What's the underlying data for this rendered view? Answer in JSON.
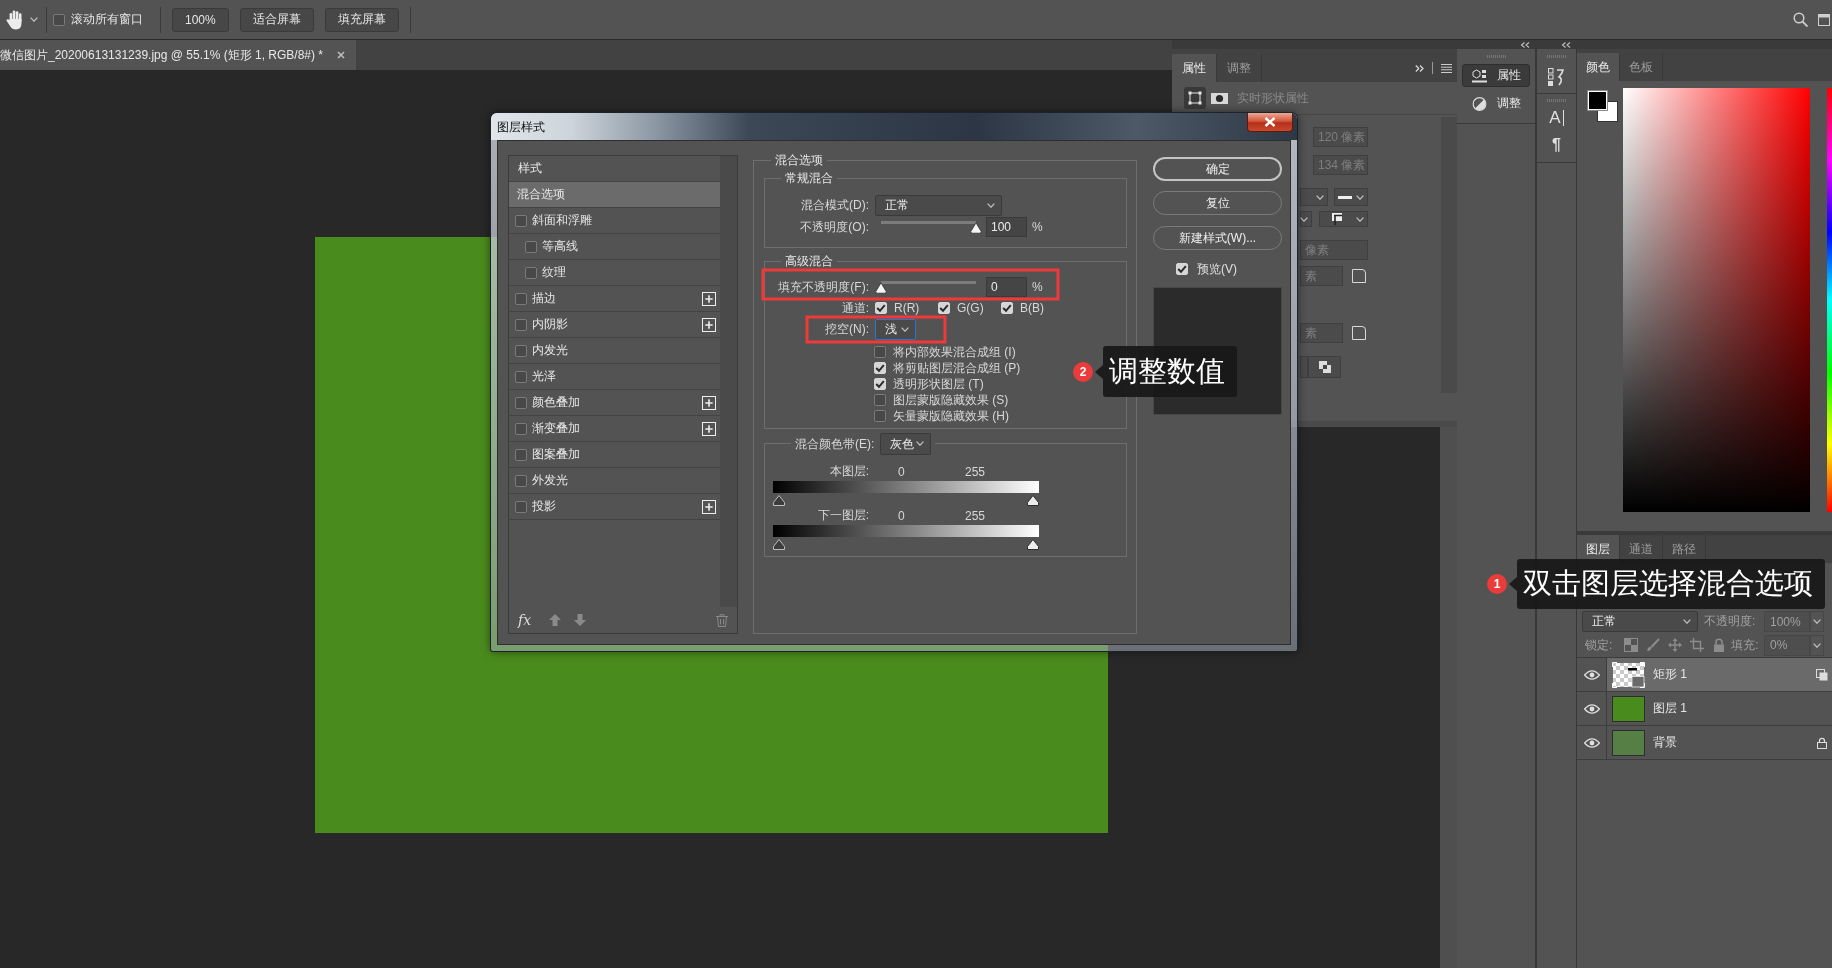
{
  "options_bar": {
    "scroll_all": {
      "label": "滚动所有窗口",
      "checked": false
    },
    "buttons": [
      "100%",
      "适合屏幕",
      "填充屏幕"
    ]
  },
  "document_tabs": [
    {
      "title": "微信图片_20200613131239.jpg @ 55.1% (矩形 1, RGB/8#) *",
      "selected": true
    }
  ],
  "dialog": {
    "title": "图层样式",
    "styles_header": "样式",
    "styles": [
      {
        "label": "混合选项",
        "kind": "heading",
        "selected": true
      },
      {
        "label": "斜面和浮雕",
        "kind": "effect",
        "checked": false,
        "selected": false,
        "addable": false,
        "children": [
          {
            "label": "等高线",
            "kind": "effect",
            "checked": false,
            "selected": false,
            "addable": false
          },
          {
            "label": "纹理",
            "kind": "effect",
            "checked": false,
            "selected": false,
            "addable": false
          }
        ]
      },
      {
        "label": "描边",
        "kind": "effect",
        "checked": false,
        "selected": false,
        "addable": true
      },
      {
        "label": "内阴影",
        "kind": "effect",
        "checked": false,
        "selected": false,
        "addable": true
      },
      {
        "label": "内发光",
        "kind": "effect",
        "checked": false,
        "selected": false,
        "addable": false
      },
      {
        "label": "光泽",
        "kind": "effect",
        "checked": false,
        "selected": false,
        "addable": false
      },
      {
        "label": "颜色叠加",
        "kind": "effect",
        "checked": false,
        "selected": false,
        "addable": true
      },
      {
        "label": "渐变叠加",
        "kind": "effect",
        "checked": false,
        "selected": false,
        "addable": true
      },
      {
        "label": "图案叠加",
        "kind": "effect",
        "checked": false,
        "selected": false,
        "addable": false
      },
      {
        "label": "外发光",
        "kind": "effect",
        "checked": false,
        "selected": false,
        "addable": false
      },
      {
        "label": "投影",
        "kind": "effect",
        "checked": false,
        "selected": false,
        "addable": true
      }
    ],
    "effects_button": "fx",
    "blending": {
      "title": "混合选项",
      "general": {
        "title": "常规混合",
        "blend_mode": {
          "label": "混合模式(D):",
          "value": "正常"
        },
        "opacity": {
          "label": "不透明度(O):",
          "level": 1,
          "value": "100",
          "unit": "%"
        }
      },
      "advanced": {
        "title": "高级混合",
        "fill_opacity": {
          "label": "填充不透明度(F):",
          "level": 0,
          "value": "0",
          "unit": "%"
        },
        "channels_label": "通道:",
        "channels": [
          {
            "label": "R(R)",
            "checked": true
          },
          {
            "label": "G(G)",
            "checked": true
          },
          {
            "label": "B(B)",
            "checked": true
          }
        ],
        "knockout": {
          "label": "挖空(N):",
          "value": "浅",
          "focused": true
        },
        "options": [
          {
            "label": "将内部效果混合成组 (I)",
            "checked": false
          },
          {
            "label": "将剪贴图层混合成组 (P)",
            "checked": true
          },
          {
            "label": "透明形状图层 (T)",
            "checked": true
          },
          {
            "label": "图层蒙版隐藏效果 (S)",
            "checked": false
          },
          {
            "label": "矢量蒙版隐藏效果 (H)",
            "checked": false
          }
        ]
      },
      "blend_if": {
        "label": "混合颜色带(E):",
        "value": "灰色",
        "bands": [
          {
            "label": "本图层:",
            "low": "0",
            "high": "255"
          },
          {
            "label": "下一图层:",
            "low": "0",
            "high": "255"
          }
        ]
      }
    },
    "buttons": [
      {
        "label": "确定",
        "default": true
      },
      {
        "label": "复位",
        "default": false
      },
      {
        "label": "新建样式(W)...",
        "default": false
      }
    ],
    "preview": {
      "label": "预览(V)",
      "checked": true
    }
  },
  "properties_panel": {
    "tabs": [
      {
        "label": "属性",
        "selected": true
      },
      {
        "label": "调整",
        "selected": false
      }
    ],
    "heading": "实时形状属性",
    "fields": [
      {
        "kind": "size",
        "value": "120 像素",
        "disabled": true
      },
      {
        "kind": "size",
        "value": "134 像素",
        "disabled": true
      },
      {
        "kind": "wide",
        "value": "像素",
        "disabled": true
      },
      {
        "kind": "corner",
        "value": "素",
        "disabled": true
      },
      {
        "kind": "corner",
        "value": "素",
        "disabled": true
      }
    ]
  },
  "dock": {
    "buttons": [
      {
        "label": "属性",
        "selected": true
      },
      {
        "label": "调整",
        "selected": false
      }
    ],
    "tool_glyphs": [
      "A",
      "¶"
    ]
  },
  "color_panel": {
    "tabs": [
      {
        "label": "颜色",
        "selected": true
      },
      {
        "label": "色板",
        "selected": false
      }
    ]
  },
  "layers_panel": {
    "tabs": [
      {
        "label": "图层",
        "selected": true
      },
      {
        "label": "通道",
        "selected": false
      },
      {
        "label": "路径",
        "selected": false
      }
    ],
    "blend_mode": "正常",
    "opacity_label": "不透明度:",
    "opacity": "100%",
    "lock_label": "锁定:",
    "fill_label": "填充:",
    "fill": "0%",
    "layers": [
      {
        "name": "矩形 1",
        "kind": "shape",
        "selected": true,
        "visible": true,
        "locked": false
      },
      {
        "name": "图层 1",
        "kind": "fill",
        "selected": false,
        "visible": true,
        "locked": false
      },
      {
        "name": "背景",
        "kind": "photo",
        "selected": false,
        "visible": true,
        "locked": true
      }
    ]
  },
  "annotations": [
    {
      "number": "1",
      "text": "双击图层选择混合选项"
    },
    {
      "number": "2",
      "text": "调整数值"
    }
  ]
}
